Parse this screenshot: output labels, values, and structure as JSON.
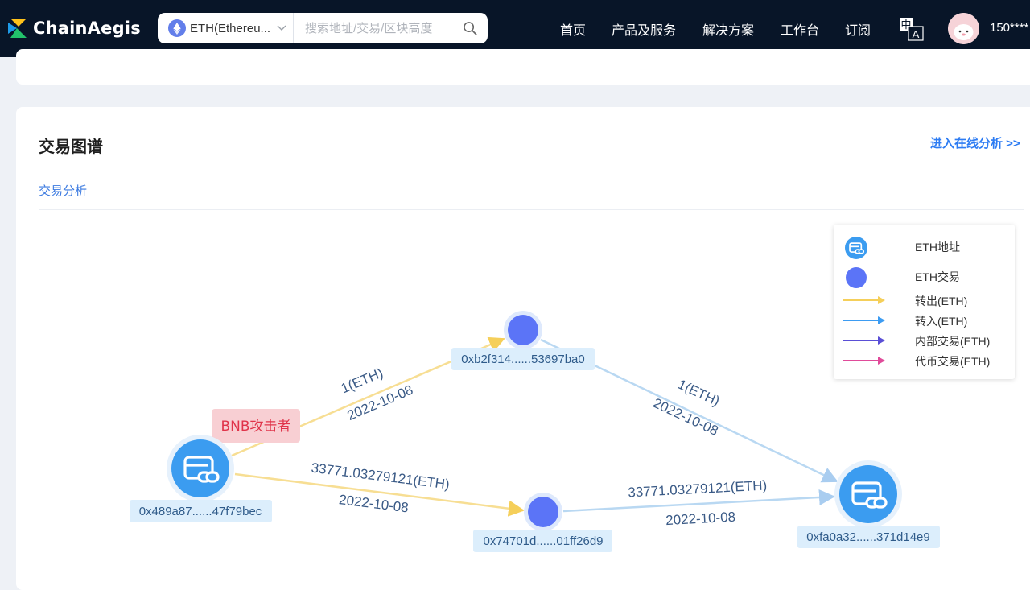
{
  "brand": {
    "name": "ChainAegis"
  },
  "search": {
    "chain_label": "ETH(Ethereu...",
    "placeholder": "搜索地址/交易/区块高度"
  },
  "menu": {
    "home": "首页",
    "products": "产品及服务",
    "solutions": "解决方案",
    "workbench": "工作台",
    "subscribe": "订阅"
  },
  "user": {
    "name": "150****"
  },
  "panel": {
    "title": "交易图谱",
    "online_link": "进入在线分析 >>",
    "tab": "交易分析"
  },
  "graph": {
    "attacker_tag": "BNB攻击者",
    "nodes": {
      "source": "0x489a87......47f79bec",
      "tx_top": "0xb2f314......53697ba0",
      "tx_bottom": "0x74701d......01ff26d9",
      "target": "0xfa0a32......371d14e9"
    },
    "edges": {
      "e1_amount": "1(ETH)",
      "e1_date": "2022-10-08",
      "e2_amount": "1(ETH)",
      "e2_date": "2022-10-08",
      "e3_amount": "33771.03279121(ETH)",
      "e3_date": "2022-10-08",
      "e4_amount": "33771.03279121(ETH)",
      "e4_date": "2022-10-08"
    },
    "colors": {
      "out": "#f5cf5a",
      "in": "#3d9cf2",
      "internal": "#5a4fd6",
      "token": "#e04b9a",
      "tx_node": "#5b74f7",
      "address_node": "#3b9cf0"
    }
  },
  "legend": {
    "address": "ETH地址",
    "transaction": "ETH交易",
    "out": "转出(ETH)",
    "in": "转入(ETH)",
    "internal": "内部交易(ETH)",
    "token": "代币交易(ETH)"
  }
}
